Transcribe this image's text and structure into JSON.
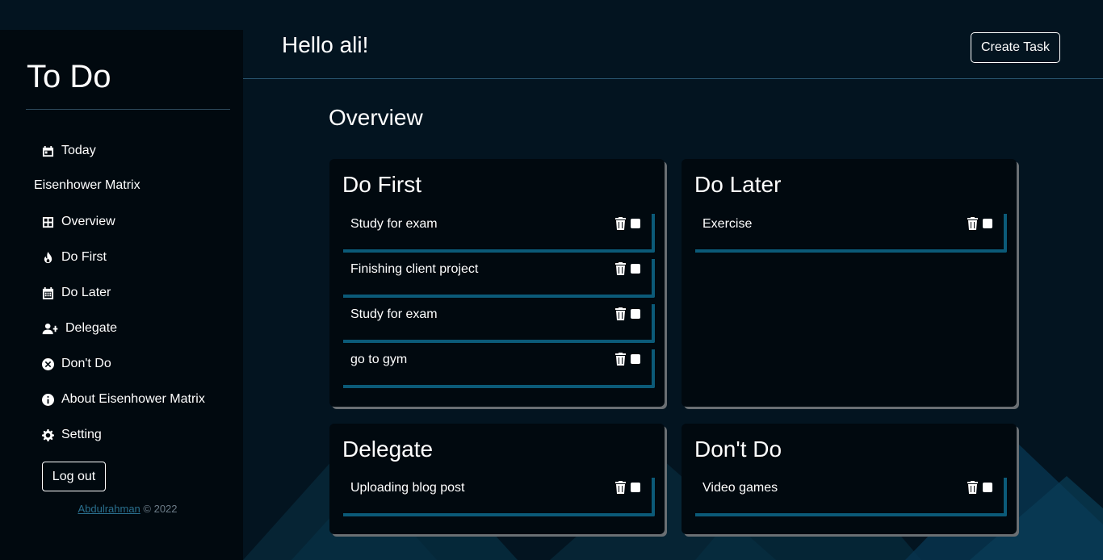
{
  "sidebar": {
    "brand": "To Do",
    "items": [
      {
        "label": "Today",
        "icon": "calendar-day-icon"
      },
      {
        "label": "Overview",
        "icon": "grid-icon"
      },
      {
        "label": "Do First",
        "icon": "fire-icon"
      },
      {
        "label": "Do Later",
        "icon": "calendar-icon"
      },
      {
        "label": "Delegate",
        "icon": "user-plus-icon"
      },
      {
        "label": "Don't Do",
        "icon": "circle-x-icon"
      },
      {
        "label": "About Eisenhower Matrix",
        "icon": "info-circle-icon"
      },
      {
        "label": "Setting",
        "icon": "gear-icon"
      }
    ],
    "heading": "Eisenhower Matrix",
    "logout_label": "Log out",
    "footer_author": "Abdulrahman",
    "footer_copy": "© 2022"
  },
  "header": {
    "greeting": "Hello ali!",
    "create_label": "Create Task"
  },
  "main": {
    "title": "Overview",
    "cards": [
      {
        "title": "Do First",
        "tasks": [
          "Study for exam",
          "Finishing client project",
          "Study for exam",
          "go to gym"
        ]
      },
      {
        "title": "Do Later",
        "tasks": [
          "Exercise"
        ]
      },
      {
        "title": "Delegate",
        "tasks": [
          "Uploading blog post"
        ]
      },
      {
        "title": "Don't Do",
        "tasks": [
          "Video games"
        ]
      }
    ]
  },
  "colors": {
    "background": "#031420",
    "sidebar": "#01090f",
    "card": "#01090f",
    "accent": "#0b5a78",
    "link": "#2a6f8e"
  }
}
